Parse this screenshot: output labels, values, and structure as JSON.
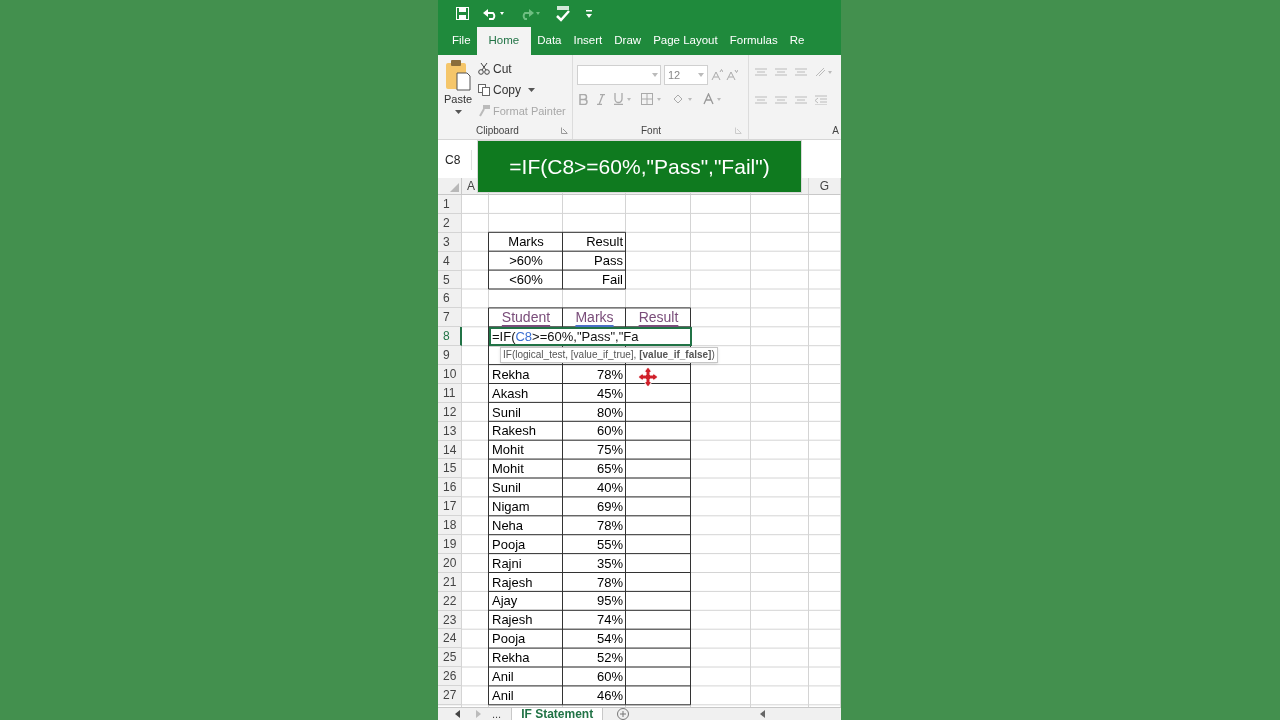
{
  "tabs": [
    {
      "label": "File",
      "selected": false
    },
    {
      "label": "Home",
      "selected": true
    },
    {
      "label": "Data",
      "selected": false
    },
    {
      "label": "Insert",
      "selected": false
    },
    {
      "label": "Draw",
      "selected": false
    },
    {
      "label": "Page Layout",
      "selected": false
    },
    {
      "label": "Formulas",
      "selected": false
    },
    {
      "label": "Re",
      "selected": false
    }
  ],
  "ribbon": {
    "clipboard": {
      "paste": "Paste",
      "cut": "Cut",
      "copy": "Copy",
      "format_painter": {
        "label": "Format Painter",
        "disabled": true
      },
      "group_label": "Clipboard"
    },
    "font": {
      "size": "12",
      "group_label": "Font"
    },
    "alignment": {
      "group_label": "A"
    }
  },
  "name_box": "C8",
  "formula_banner": "=IF(C8>=60%,\"Pass\",\"Fail\")",
  "column_headers": [
    "A",
    "G"
  ],
  "row_numbers": [
    "1",
    "2",
    "3",
    "4",
    "5",
    "6",
    "7",
    "8",
    "9",
    "10",
    "11",
    "12",
    "13",
    "14",
    "15",
    "16",
    "17",
    "18",
    "19",
    "20",
    "21",
    "22",
    "23",
    "24",
    "25",
    "26",
    "27"
  ],
  "legend_table": {
    "columns": [
      "Marks",
      "Result"
    ],
    "rows": [
      [
        ">60%",
        "Pass"
      ],
      [
        "<60%",
        "Fail"
      ]
    ]
  },
  "student_table": {
    "columns": [
      "Student",
      "Marks",
      "Result"
    ],
    "editing_cell": [
      {
        "kind": "text",
        "text": "=IF("
      },
      {
        "kind": "reference",
        "text": "C8"
      },
      {
        "kind": "text",
        "text": ">=60%,\"Pass\",\"Fa"
      }
    ],
    "tooltip": "IF(logical_test, [value_if_true], **[value_if_false]**)",
    "rows": [
      [
        "Rekha",
        "78%"
      ],
      [
        "Akash",
        "45%"
      ],
      [
        "Sunil",
        "80%"
      ],
      [
        "Rakesh",
        "60%"
      ],
      [
        "Mohit",
        "75%"
      ],
      [
        "Mohit",
        "65%"
      ],
      [
        "Sunil",
        "40%"
      ],
      [
        "Nigam",
        "69%"
      ],
      [
        "Neha",
        "78%"
      ],
      [
        "Pooja",
        "55%"
      ],
      [
        "Rajni",
        "35%"
      ],
      [
        "Rajesh",
        "78%"
      ],
      [
        "Ajay",
        "95%"
      ],
      [
        "Rajesh",
        "74%"
      ],
      [
        "Pooja",
        "54%"
      ],
      [
        "Rekha",
        "52%"
      ],
      [
        "Anil",
        "60%"
      ],
      [
        "Anil",
        "46%"
      ]
    ]
  },
  "sheet_tabs": {
    "more": "...",
    "tabs": [
      {
        "label": "IF Statement",
        "selected": true
      }
    ]
  }
}
